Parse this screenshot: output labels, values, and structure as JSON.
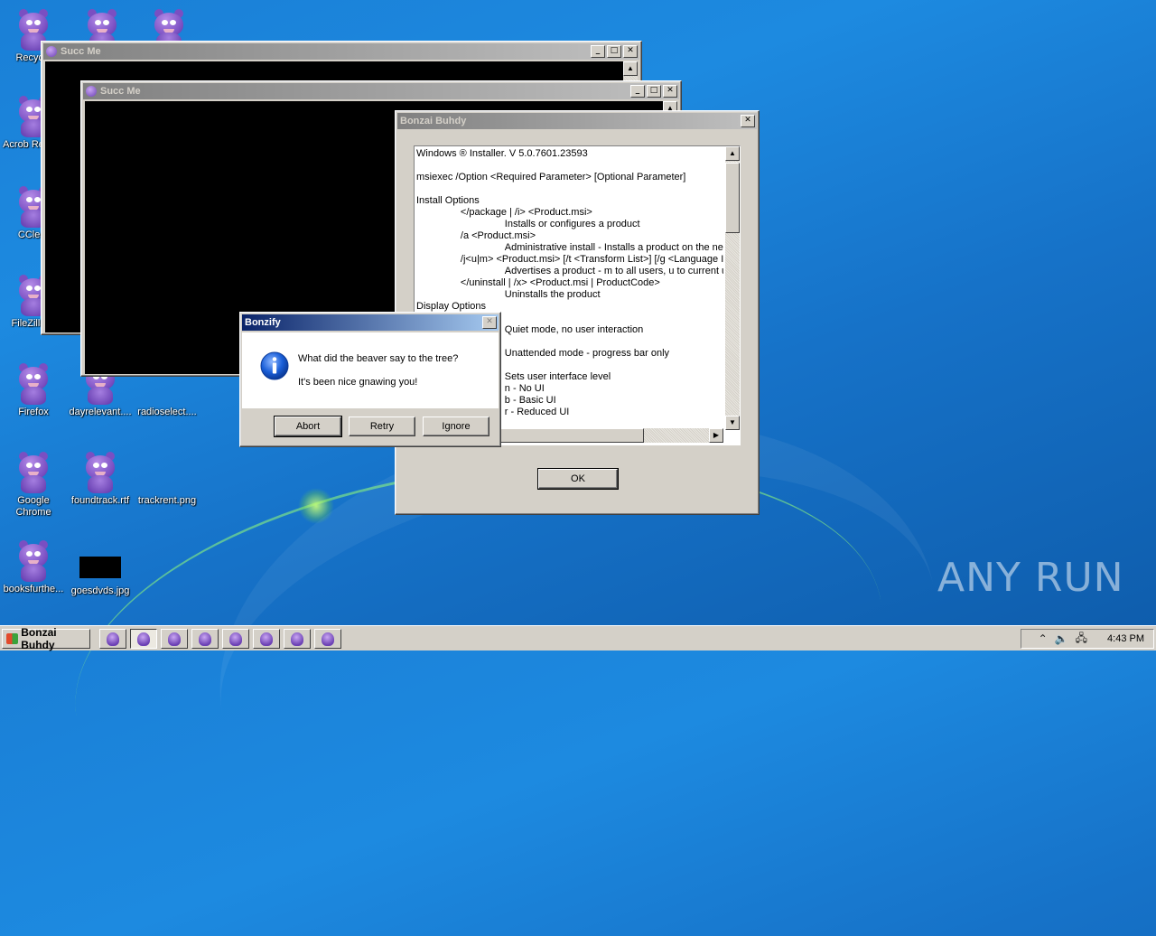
{
  "desktop": {
    "icons": [
      {
        "label": "Recycle"
      },
      {
        "label": "Acrob Reader"
      },
      {
        "label": "CClear"
      },
      {
        "label": "FileZilla C"
      },
      {
        "label": "Firefox"
      },
      {
        "label": "Google Chrome"
      },
      {
        "label": "booksfurthe..."
      },
      {
        "label": "dayrelevant...."
      },
      {
        "label": "radioselect...."
      },
      {
        "label": "foundtrack.rtf"
      },
      {
        "label": "trackrent.png"
      },
      {
        "label": "goesdvds.jpg"
      }
    ],
    "watermark": "ANY RUN"
  },
  "windows": {
    "succ1": {
      "title": "Succ Me"
    },
    "succ2": {
      "title": "Succ Me"
    },
    "buhdy": {
      "title": "Bonzai Buhdy",
      "lines": [
        "Windows ® Installer. V 5.0.7601.23593",
        "",
        "msiexec /Option <Required Parameter> [Optional Parameter]",
        "",
        "Install Options",
        "                </package | /i> <Product.msi>",
        "                                Installs or configures a product",
        "                /a <Product.msi>",
        "                                Administrative install - Installs a product on the netwo",
        "                /j<u|m> <Product.msi> [/t <Transform List>] [/g <Language ID",
        "                                Advertises a product - m to all users, u to current user",
        "                </uninstall | /x> <Product.msi | ProductCode>",
        "                                Uninstalls the product",
        "Display Options",
        "",
        "                                Quiet mode, no user interaction",
        "",
        "                                Unattended mode - progress bar only",
        "",
        "                                Sets user interface level",
        "                                n - No UI",
        "                                b - Basic UI",
        "                                r - Reduced UI"
      ],
      "ok_label": "OK"
    },
    "bonzify": {
      "title": "Bonzify",
      "message1": "What did the beaver say to the tree?",
      "message2": "It's been nice gnawing you!",
      "abort_label": "Abort",
      "retry_label": "Retry",
      "ignore_label": "Ignore"
    }
  },
  "taskbar": {
    "start_label": "Bonzai Buhdy",
    "clock": "4:43 PM"
  }
}
